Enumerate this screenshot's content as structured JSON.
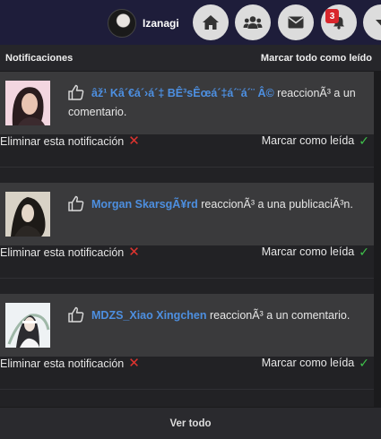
{
  "header": {
    "username": "Izanagi",
    "notification_count": "3",
    "icons": [
      "home-icon",
      "users-icon",
      "envelope-icon",
      "notification-bell-icon",
      "chevron-down-icon"
    ]
  },
  "panel": {
    "title": "Notificaciones",
    "mark_all": "Marcar todo como leído"
  },
  "notifications": [
    {
      "user": "âž¹ Kâ´€á´›á´‡ BÊ³sÊœá´‡á´¨á´¨ Â©",
      "action": " reaccionÃ³ a un comentario.",
      "delete_label": "Eliminar esta notificación",
      "read_label": "Marcar como leída"
    },
    {
      "user": "Morgan SkarsgÃ¥rd",
      "action": " reaccionÃ³ a una publicaciÃ³n.",
      "delete_label": "Eliminar esta notificación",
      "read_label": "Marcar como leída"
    },
    {
      "user": "MDZS_Xiao Xingchen",
      "action": " reaccionÃ³ a un comentario.",
      "delete_label": "Eliminar esta notificación",
      "read_label": "Marcar como leída"
    }
  ],
  "footer": {
    "view_all": "Ver todo"
  },
  "colors": {
    "topbar": "#1e1d3a",
    "panel_bg": "#222225",
    "card_bg": "#3a3a3c",
    "link_blue": "#4d8fe0",
    "delete_red": "#e0342f",
    "check_green": "#3fc24b",
    "badge_red": "#d8262c"
  }
}
